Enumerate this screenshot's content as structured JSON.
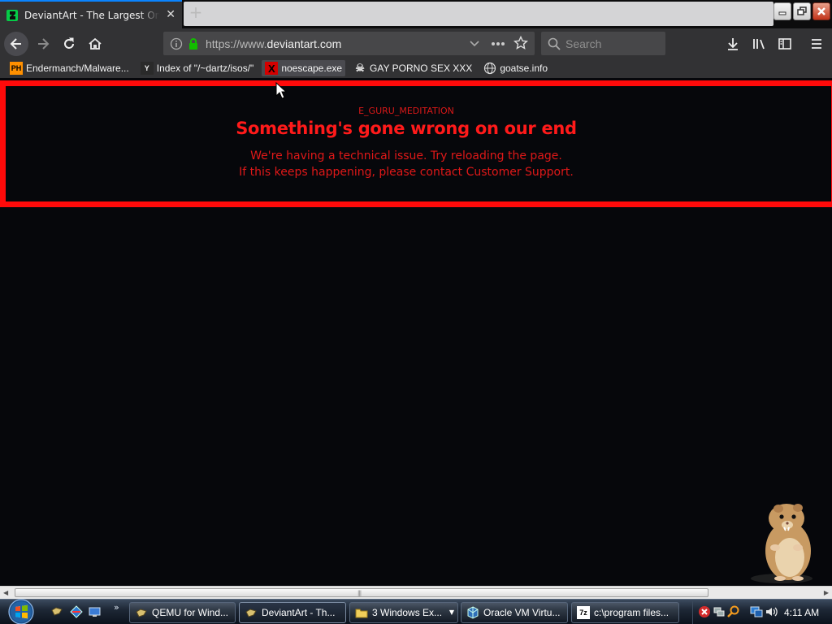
{
  "browser": {
    "tab": {
      "title": "DeviantArt - The Largest Online Art Gallery and Community",
      "close": "✕"
    },
    "new_tab": "+",
    "url": {
      "scheme": "https://www.",
      "host": "deviantart.com"
    },
    "search": {
      "placeholder": "Search"
    },
    "bookmarks": [
      {
        "icon": "pornhub-icon",
        "icon_text": "PH",
        "label": "Endermanch/Malware..."
      },
      {
        "icon": "ycombinator-icon",
        "icon_text": "Y",
        "label": "Index of \"/~dartz/isos/\""
      },
      {
        "icon": "x-icon",
        "icon_text": "X",
        "label": "noescape.exe"
      },
      {
        "icon": "skull-icon",
        "icon_text": "☠",
        "label": "GAY PORNO SEX XXX"
      },
      {
        "icon": "globe-icon",
        "icon_text": "",
        "label": "goatse.info"
      }
    ]
  },
  "page": {
    "error_code": "E_GURU_MEDITATION",
    "heading": "Something's gone wrong on our end",
    "line1": "We're having a technical issue. Try reloading the page.",
    "line2": "If this keeps happening, please contact Customer Support."
  },
  "taskbar": {
    "tasks": [
      {
        "icon": "qemu-icon",
        "label": "QEMU for Wind..."
      },
      {
        "icon": "firefox-icon",
        "label": "DeviantArt - Th..."
      },
      {
        "icon": "folder-icon",
        "label": "3 Windows Ex..."
      },
      {
        "icon": "virtualbox-icon",
        "label": "Oracle VM Virtu..."
      },
      {
        "icon": "7zip-icon",
        "icon_text": "7z",
        "label": "c:\\program files..."
      }
    ],
    "more": "»",
    "clock": "4:11 AM"
  },
  "colors": {
    "error_red": "#ff1a1a",
    "page_bg": "#06070b",
    "toolbar": "#323234",
    "accent_blue": "#0a84ff"
  }
}
